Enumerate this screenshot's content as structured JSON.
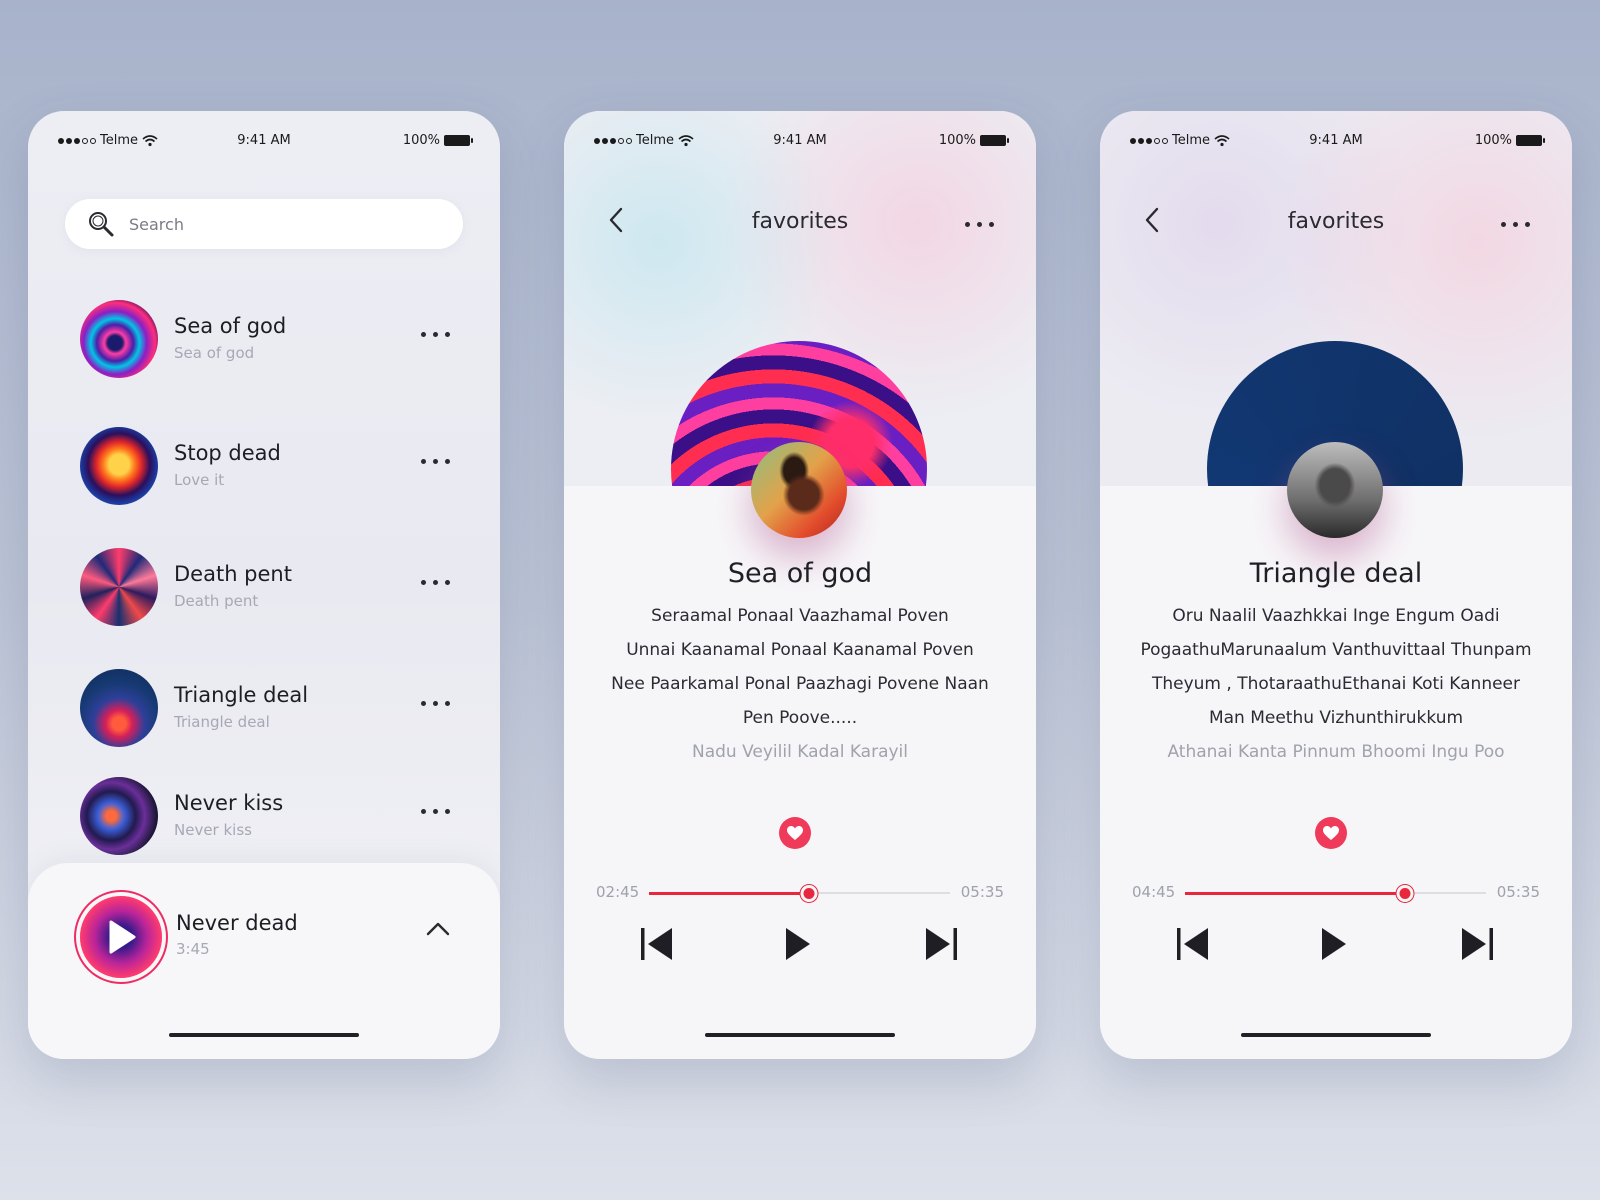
{
  "status": {
    "carrier": "Telme",
    "time": "9:41 AM",
    "battery": "100%"
  },
  "list_screen": {
    "search_placeholder": "Search",
    "items": [
      {
        "title": "Sea of god",
        "subtitle": "Sea of god"
      },
      {
        "title": "Stop dead",
        "subtitle": "Love it"
      },
      {
        "title": "Death pent",
        "subtitle": "Death pent"
      },
      {
        "title": "Triangle deal",
        "subtitle": "Triangle deal"
      },
      {
        "title": "Never kiss",
        "subtitle": "Never kiss"
      }
    ],
    "now_playing": {
      "title": "Never dead",
      "duration": "3:45"
    }
  },
  "player1": {
    "nav_title": "favorites",
    "song_title": "Sea of god",
    "lyrics": [
      "Seraamal Ponaal Vaazhamal Poven",
      "Unnai Kaanamal Ponaal Kaanamal Poven",
      "Nee Paarkamal Ponal Paazhagi Povene Naan",
      "Pen Poove.....",
      "Nadu Veyilil Kadal Karayil"
    ],
    "time_current": "02:45",
    "time_total": "05:35",
    "progress": 0.53
  },
  "player2": {
    "nav_title": "favorites",
    "song_title": "Triangle deal",
    "lyrics": [
      "Oru Naalil Vaazhkkai Inge Engum Oadi",
      "PogaathuMarunaalum Vanthuvittaal Thunpam",
      "Theyum , ThotaraathuEthanai Koti Kanneer",
      "Man Meethu Vizhunthirukkum",
      "Athanai Kanta Pinnum Bhoomi Ingu Poo"
    ],
    "time_current": "04:45",
    "time_total": "05:35",
    "progress": 0.73
  },
  "colors": {
    "accent": "#e8263c",
    "heart": "#ef3a5a"
  },
  "icons": [
    "search-icon",
    "wifi-icon",
    "battery-icon",
    "more-icon",
    "back-icon",
    "heart-icon",
    "previous-icon",
    "play-icon",
    "next-icon",
    "chevron-up-icon"
  ]
}
